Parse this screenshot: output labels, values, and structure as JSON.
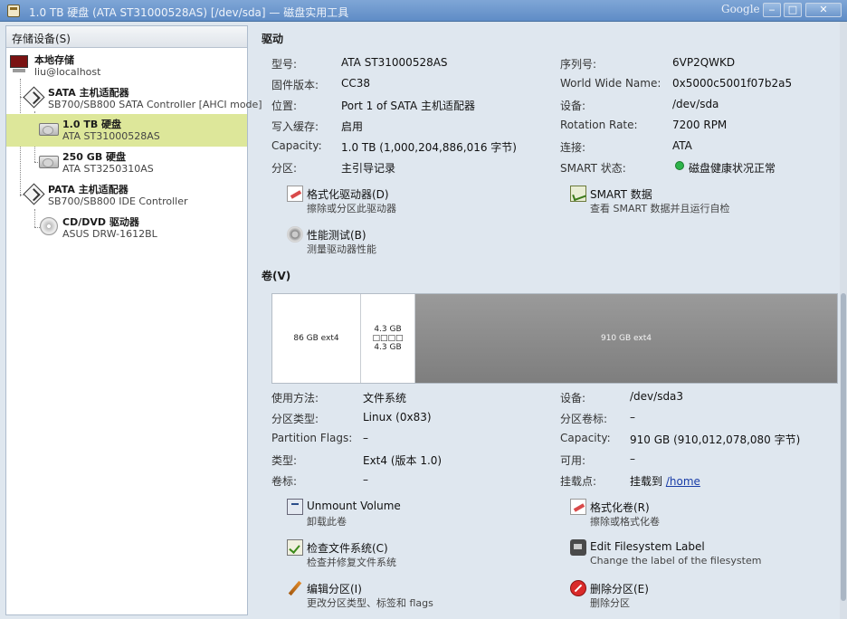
{
  "window": {
    "title": "1.0 TB 硬盘 (ATA ST31000528AS) [/dev/sda] — 磁盘实用工具",
    "brand": "Google",
    "minimize": "‒",
    "maximize": "□",
    "close": "✕"
  },
  "sidebar": {
    "header": "存储设备(S)",
    "items": [
      {
        "name": "本地存储",
        "sub": "liu@localhost",
        "icon": "computer-icon"
      },
      {
        "name": "SATA 主机适配器",
        "sub": "SB700/SB800 SATA Controller [AHCI mode]",
        "icon": "controller-icon"
      },
      {
        "name": "1.0 TB 硬盘",
        "sub": "ATA ST31000528AS",
        "icon": "harddisk-icon",
        "selected": true
      },
      {
        "name": "250 GB 硬盘",
        "sub": "ATA ST3250310AS",
        "icon": "harddisk-icon"
      },
      {
        "name": "PATA 主机适配器",
        "sub": "SB700/SB800 IDE Controller",
        "icon": "controller-icon"
      },
      {
        "name": "CD/DVD 驱动器",
        "sub": "ASUS DRW-1612BL",
        "icon": "optical-drive-icon"
      }
    ]
  },
  "drive": {
    "section_title": "驱动",
    "left": [
      {
        "label": "型号:",
        "value": "ATA ST31000528AS"
      },
      {
        "label": "固件版本:",
        "value": "CC38"
      },
      {
        "label": "位置:",
        "value": "Port 1 of SATA 主机适配器"
      },
      {
        "label": "写入缓存:",
        "value": "启用"
      },
      {
        "label": "Capacity:",
        "value": "1.0 TB (1,000,204,886,016 字节)"
      },
      {
        "label": "分区:",
        "value": "主引导记录"
      }
    ],
    "right": [
      {
        "label": "序列号:",
        "value": "6VP2QWKD"
      },
      {
        "label": "World Wide Name:",
        "value": "0x5000c5001f07b2a5"
      },
      {
        "label": "设备:",
        "value": "/dev/sda"
      },
      {
        "label": "Rotation Rate:",
        "value": "7200 RPM"
      },
      {
        "label": "连接:",
        "value": "ATA"
      },
      {
        "label": "SMART 状态:",
        "value": "磁盘健康状况正常",
        "status_color": "#2db34a"
      }
    ],
    "actions": [
      {
        "title": "格式化驱动器(D)",
        "desc": "擦除或分区此驱动器",
        "icon": "format-drive-icon"
      },
      {
        "title": "SMART 数据",
        "desc": "查看 SMART 数据并且运行自检",
        "icon": "smart-data-icon"
      },
      {
        "title": "性能测试(B)",
        "desc": "测量驱动器性能",
        "icon": "benchmark-icon"
      }
    ]
  },
  "volumes": {
    "section_title": "卷(V)",
    "map": [
      {
        "line1": "86 GB ext4",
        "line2": ""
      },
      {
        "line1": "4.3 GB □□□□",
        "line2": "4.3 GB"
      },
      {
        "line1": "910 GB ext4",
        "line2": ""
      }
    ],
    "left": [
      {
        "label": "使用方法:",
        "value": "文件系统"
      },
      {
        "label": "分区类型:",
        "value": "Linux (0x83)"
      },
      {
        "label": "Partition Flags:",
        "value": "–"
      },
      {
        "label": "类型:",
        "value": "Ext4 (版本 1.0)"
      },
      {
        "label": "卷标:",
        "value": "–"
      }
    ],
    "right": [
      {
        "label": "设备:",
        "value": "/dev/sda3"
      },
      {
        "label": "分区卷标:",
        "value": "–"
      },
      {
        "label": "Capacity:",
        "value": "910 GB (910,012,078,080 字节)"
      },
      {
        "label": "可用:",
        "value": "–"
      },
      {
        "label": "挂载点:",
        "value_prefix": "挂载到 ",
        "value_link": "/home"
      }
    ],
    "actions": [
      {
        "title": "Unmount Volume",
        "desc": "卸载此卷",
        "icon": "unmount-icon"
      },
      {
        "title": "格式化卷(R)",
        "desc": "擦除或格式化卷",
        "icon": "format-volume-icon"
      },
      {
        "title": "检查文件系统(C)",
        "desc": "检查并修复文件系统",
        "icon": "check-filesystem-icon"
      },
      {
        "title": "Edit Filesystem Label",
        "desc": "Change the label of the filesystem",
        "icon": "edit-label-icon"
      },
      {
        "title": "编辑分区(I)",
        "desc": "更改分区类型、标签和 flags",
        "icon": "edit-partition-icon"
      },
      {
        "title": "删除分区(E)",
        "desc": "删除分区",
        "icon": "delete-partition-icon"
      }
    ]
  }
}
